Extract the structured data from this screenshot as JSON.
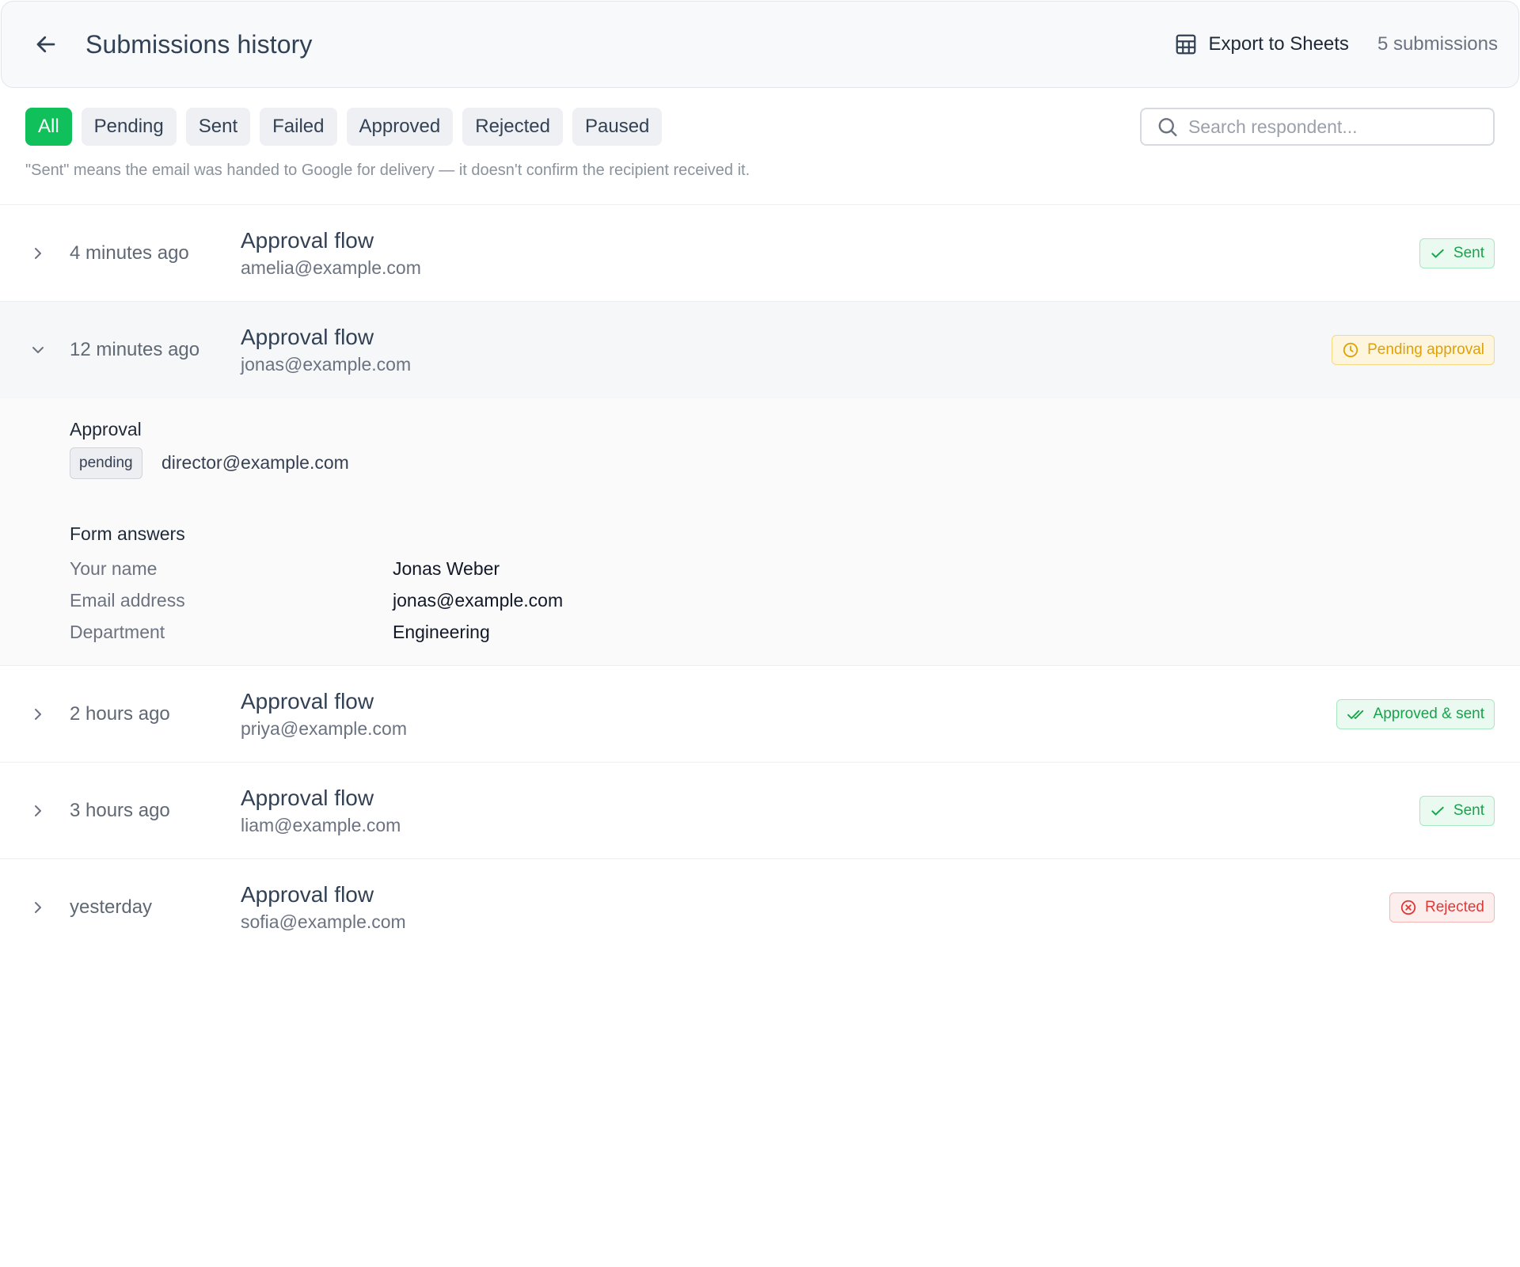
{
  "header": {
    "title": "Submissions history",
    "export_label": "Export to Sheets",
    "count": "5 submissions"
  },
  "filters": [
    "All",
    "Pending",
    "Sent",
    "Failed",
    "Approved",
    "Rejected",
    "Paused"
  ],
  "active_filter": "All",
  "search": {
    "placeholder": "Search respondent..."
  },
  "note": "\"Sent\" means the email was handed to Google for delivery — it doesn't confirm the recipient received it.",
  "submissions": [
    {
      "time": "4 minutes ago",
      "flow": "Approval flow",
      "email": "amelia@example.com",
      "status": "Sent",
      "status_type": "sent",
      "expanded": false
    },
    {
      "time": "12 minutes ago",
      "flow": "Approval flow",
      "email": "jonas@example.com",
      "status": "Pending approval",
      "status_type": "pending",
      "expanded": true
    },
    {
      "time": "2 hours ago",
      "flow": "Approval flow",
      "email": "priya@example.com",
      "status": "Approved & sent",
      "status_type": "approved",
      "expanded": false
    },
    {
      "time": "3 hours ago",
      "flow": "Approval flow",
      "email": "liam@example.com",
      "status": "Sent",
      "status_type": "sent",
      "expanded": false
    },
    {
      "time": "yesterday",
      "flow": "Approval flow",
      "email": "sofia@example.com",
      "status": "Rejected",
      "status_type": "rejected",
      "expanded": false
    }
  ],
  "detail": {
    "approval_heading": "Approval",
    "approval_status": "pending",
    "approver": "director@example.com",
    "answers_heading": "Form answers",
    "answers": [
      {
        "question": "Your name",
        "answer": "Jonas Weber"
      },
      {
        "question": "Email address",
        "answer": "jonas@example.com"
      },
      {
        "question": "Department",
        "answer": "Engineering"
      }
    ]
  },
  "colors": {
    "accent": "#10c05a",
    "sent": "#16a34a",
    "pending": "#e0a106",
    "rejected": "#e03838"
  }
}
